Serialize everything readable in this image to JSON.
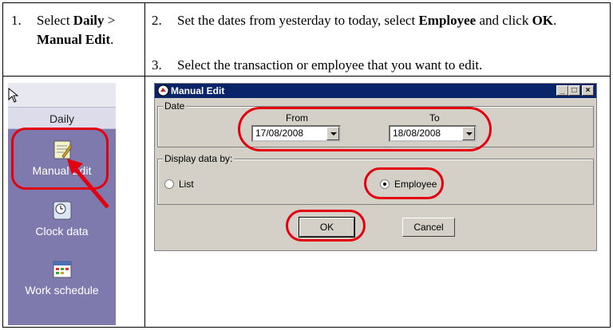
{
  "instructions": {
    "step1": {
      "number": "1.",
      "text_pre": "Select ",
      "bold1": "Daily",
      "text_mid": " > ",
      "bold2": "Manual Edit",
      "text_post": "."
    },
    "step2": {
      "number": "2.",
      "text_pre": "Set the dates from yesterday to today, select ",
      "bold1": "Employee",
      "text_mid": " and click ",
      "bold2": "OK",
      "text_post": "."
    },
    "step3": {
      "number": "3.",
      "text": "Select the transaction or employee that you want to edit."
    }
  },
  "sidebar": {
    "header": "Daily",
    "items": [
      {
        "label": "Manual Edit",
        "icon": "notepad-pencil-icon"
      },
      {
        "label": "Clock data",
        "icon": "clock-icon"
      },
      {
        "label": "Work schedule",
        "icon": "calendar-icon"
      }
    ]
  },
  "dialog": {
    "title": "Manual Edit",
    "date_group": "Date",
    "from_label": "From",
    "to_label": "To",
    "from_value": "17/08/2008",
    "to_value": "18/08/2008",
    "display_group": "Display data by:",
    "radio_list": "List",
    "radio_employee": "Employee",
    "selected": "Employee",
    "ok": "OK",
    "cancel": "Cancel"
  },
  "colors": {
    "highlight": "#e3000f",
    "sidebar_bg": "#7e7aad",
    "titlebar": "#0a246a"
  }
}
